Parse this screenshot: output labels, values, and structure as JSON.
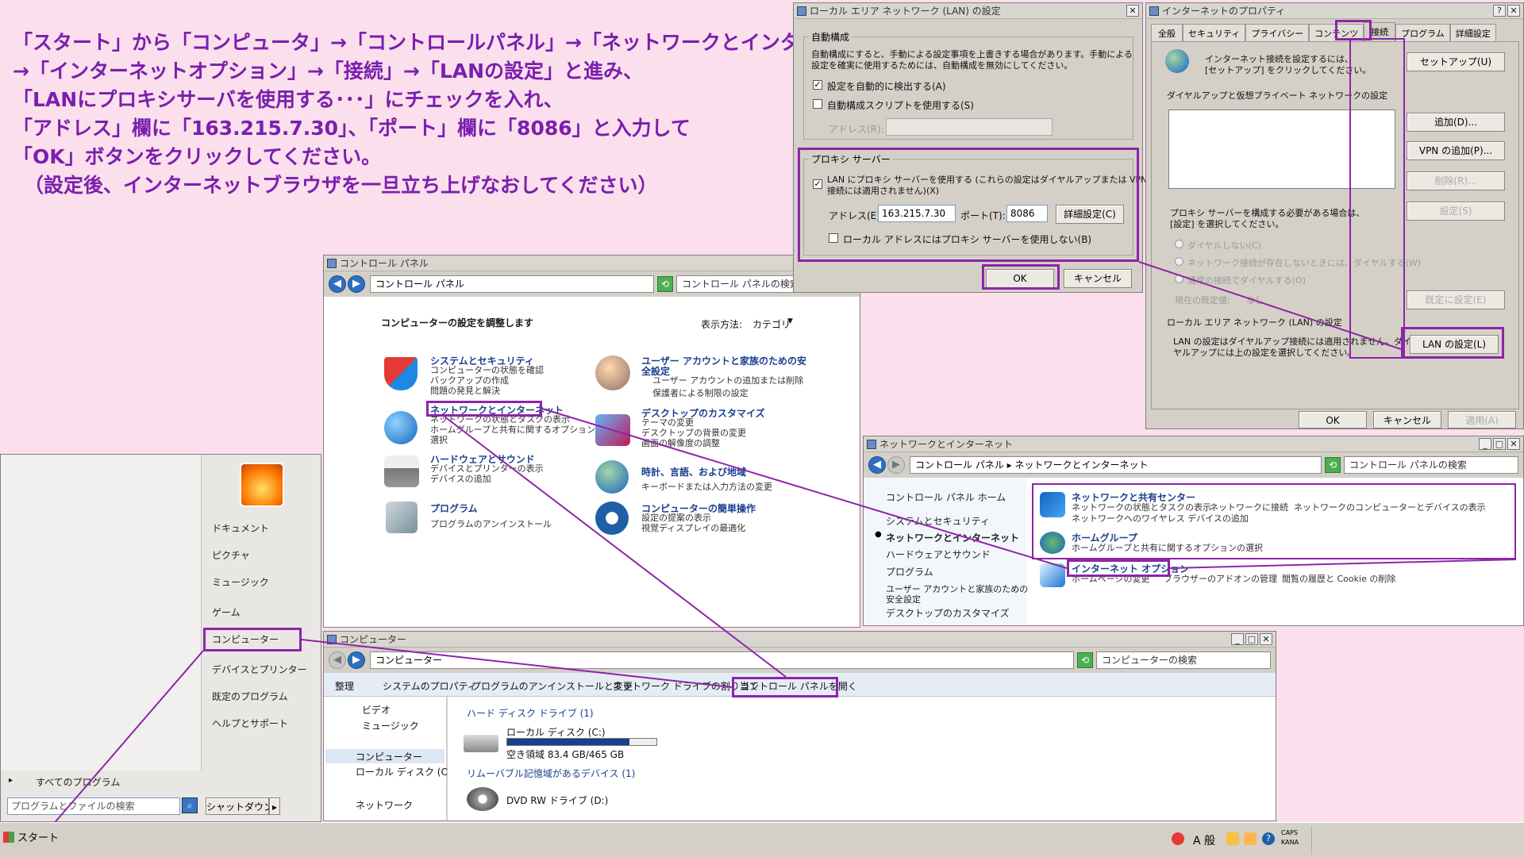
{
  "instructions": [
    "「スタート」から「コンピュータ」→「コントロールパネル」→「ネットワークとインターネット」",
    "→「インターネットオプション」→「接続」→「LANの設定」と進み、",
    "「LANにプロキシサーバを使用する･･･」にチェックを入れ、",
    "「アドレス」欄に「163.215.7.30」、「ポート」欄に「8086」と入力して",
    "「OK」ボタンをクリックしてください。",
    "（設定後、インターネットブラウザを一旦立ち上げなおしてください）"
  ],
  "lan_dialog": {
    "title": "ローカル エリア ネットワーク (LAN) の設定",
    "auto_group": "自動構成",
    "auto_desc_1": "自動構成にすると、手動による設定事項を上書きする場合があります。手動による",
    "auto_desc_2": "設定を確実に使用するためには、自動構成を無効にしてください。",
    "auto_detect": "設定を自動的に検出する(A)",
    "auto_script": "自動構成スクリプトを使用する(S)",
    "address_label": "アドレス(R):",
    "proxy_group": "プロキシ サーバー",
    "use_proxy_1": "LAN にプロキシ サーバーを使用する (これらの設定はダイヤルアップまたは VPN",
    "use_proxy_2": "接続には適用されません)(X)",
    "proxy_address_label": "アドレス(E):",
    "proxy_address": "163.215.7.30",
    "port_label": "ポート(T):",
    "port": "8086",
    "advanced": "詳細設定(C)",
    "bypass_local": "ローカル アドレスにはプロキシ サーバーを使用しない(B)",
    "ok": "OK",
    "cancel": "キャンセル"
  },
  "inet_props": {
    "title": "インターネットのプロパティ",
    "tabs": [
      "全般",
      "セキュリティ",
      "プライバシー",
      "コンテンツ",
      "接続",
      "プログラム",
      "詳細設定"
    ],
    "setup_desc_1": "インターネット接続を設定するには、",
    "setup_desc_2": "[セットアップ] をクリックしてください。",
    "setup": "セットアップ(U)",
    "dialup_label": "ダイヤルアップと仮想プライベート ネットワークの設定",
    "add": "追加(D)...",
    "add_vpn": "VPN の追加(P)...",
    "remove": "削除(R)...",
    "settings": "設定(S)",
    "proxy_need_1": "プロキシ サーバーを構成する必要がある場合は、",
    "proxy_need_2": "[設定] を選択してください。",
    "radio_1": "ダイヤルしない(C)",
    "radio_2": "ネットワーク接続が存在しないときには、ダイヤルする(W)",
    "radio_3": "通常の接続でダイヤルする(O)",
    "current_default_label": "現在の既定値:",
    "current_default": "なし",
    "set_default": "既定に設定(E)",
    "lan_group": "ローカル エリア ネットワーク (LAN) の設定",
    "lan_desc_1": "LAN の設定はダイヤルアップ接続には適用されません。ダイ",
    "lan_desc_2": "ヤルアップには上の設定を選択してください。",
    "lan_settings": "LAN の設定(L)",
    "ok": "OK",
    "cancel": "キャンセル",
    "apply": "適用(A)"
  },
  "control_panel": {
    "title": "コントロール パネル",
    "address": "コントロール パネル",
    "search": "コントロール パネルの検索",
    "heading": "コンピューターの設定を調整します",
    "view_by_label": "表示方法:",
    "view_by_value": "カテゴリ",
    "categories": [
      {
        "title": "システムとセキュリティ",
        "subs": [
          "コンピューターの状態を確認",
          "バックアップの作成",
          "問題の発見と解決"
        ]
      },
      {
        "title": "ネットワークとインターネット",
        "subs": [
          "ネットワークの状態とタスクの表示",
          "ホームグループと共有に関するオプションの",
          "選択"
        ]
      },
      {
        "title": "ハードウェアとサウンド",
        "subs": [
          "デバイスとプリンターの表示",
          "デバイスの追加"
        ]
      },
      {
        "title": "プログラム",
        "subs": [
          "プログラムのアンインストール"
        ]
      },
      {
        "title": "ユーザー アカウントと家族のための安",
        "title2": "全設定",
        "subs": [
          "ユーザー アカウントの追加または削除",
          "保護者による制限の設定"
        ]
      },
      {
        "title": "デスクトップのカスタマイズ",
        "subs": [
          "テーマの変更",
          "デスクトップの背景の変更",
          "画面の解像度の調整"
        ]
      },
      {
        "title": "時計、言語、および地域",
        "subs": [
          "キーボードまたは入力方法の変更"
        ]
      },
      {
        "title": "コンピューターの簡単操作",
        "subs": [
          "設定の提案の表示",
          "視覚ディスプレイの最適化"
        ]
      }
    ]
  },
  "network_window": {
    "title": "ネットワークとインターネット",
    "address_1": "コントロール パネル",
    "address_2": "ネットワークとインターネット",
    "search": "コントロール パネルの検索",
    "side": [
      "コントロール パネル ホーム",
      "システムとセキュリティ",
      "ネットワークとインターネット",
      "ハードウェアとサウンド",
      "プログラム",
      "ユーザー アカウントと家族のための",
      "安全設定",
      "デスクトップのカスタマイズ"
    ],
    "items": [
      {
        "title": "ネットワークと共有センター",
        "links": [
          "ネットワークの状態とタスクの表示",
          "ネットワークに接続",
          "ネットワークのコンピューターとデバイスの表示",
          "ネットワークへのワイヤレス デバイスの追加"
        ]
      },
      {
        "title": "ホームグループ",
        "links": [
          "ホームグループと共有に関するオプションの選択"
        ]
      },
      {
        "title": "インターネット オプション",
        "links": [
          "ホームページの変更",
          "ブラウザーのアドオンの管理",
          "閲覧の履歴と Cookie の削除"
        ]
      }
    ]
  },
  "computer_window": {
    "title": "コンピューター",
    "address": "コンピューター",
    "search": "コンピューターの検索",
    "toolbar": [
      "整理",
      "システムのプロパティ",
      "プログラムのアンインストールと変更",
      "ネットワーク ドライブの割り当て",
      "コントロール パネルを開く"
    ],
    "nav": [
      "ビデオ",
      "ミュージック",
      "コンピューター",
      "ローカル ディスク (C",
      "ネットワーク"
    ],
    "hdd_group": "ハード ディスク ドライブ (1)",
    "disk_name": "ローカル ディスク (C:)",
    "disk_free": "空き領域 83.4 GB/465 GB",
    "disk_used_fraction": 0.82,
    "removable_group": "リムーバブル記憶域があるデバイス (1)",
    "dvd": "DVD RW ドライブ (D:)"
  },
  "start_menu": {
    "items": [
      "ドキュメント",
      "ピクチャ",
      "ミュージック",
      "ゲーム",
      "コンピューター",
      "デバイスとプリンター",
      "既定のプログラム",
      "ヘルプとサポート"
    ],
    "all_programs": "すべてのプログラム",
    "search": "プログラムとファイルの検索",
    "shutdown": "シャットダウン"
  },
  "taskbar": {
    "start": "スタート",
    "ime": "A 般",
    "caps": "CAPS",
    "kana": "KANA"
  },
  "colors": {
    "accent": "#8e24a8",
    "instruction": "#7a1fb0",
    "background": "#fbdfec"
  }
}
